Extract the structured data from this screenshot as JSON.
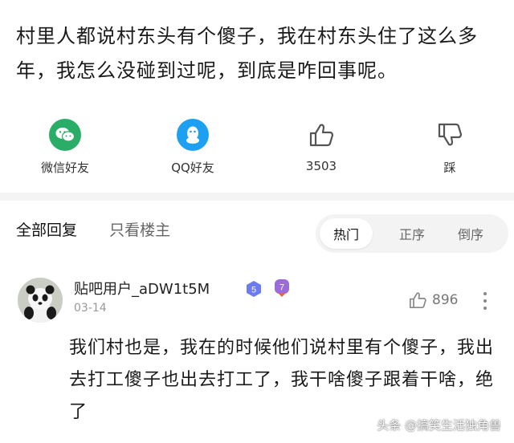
{
  "post": {
    "text": "村里人都说村东头有个傻子，我在村东头住了这么多年，我怎么没碰到过呢，到底是咋回事呢。"
  },
  "share": {
    "wechat_label": "微信好友",
    "qq_label": "QQ好友",
    "like_count": "3503",
    "dislike_label": "踩"
  },
  "reply_tabs": {
    "all": "全部回复",
    "op_only": "只看楼主"
  },
  "sort": {
    "hot": "热门",
    "asc": "正序",
    "desc": "倒序",
    "selected": "hot"
  },
  "comment": {
    "username": "贴吧用户_aDW1t5M",
    "level": "5",
    "vip_level": "7",
    "date": "03-14",
    "likes": "896",
    "text": "我们村也是，我在的时候他们说村里有个傻子，我出去打工傻子也出去打工了，我干啥傻子跟着干啥，绝了"
  },
  "watermark": "头条 @搞笑生活独角兽",
  "colors": {
    "wechat": "#2aae67",
    "qq": "#1ea0f2",
    "level_badge": "#6c7bf0",
    "vip_badge": "#9b6cd8"
  }
}
